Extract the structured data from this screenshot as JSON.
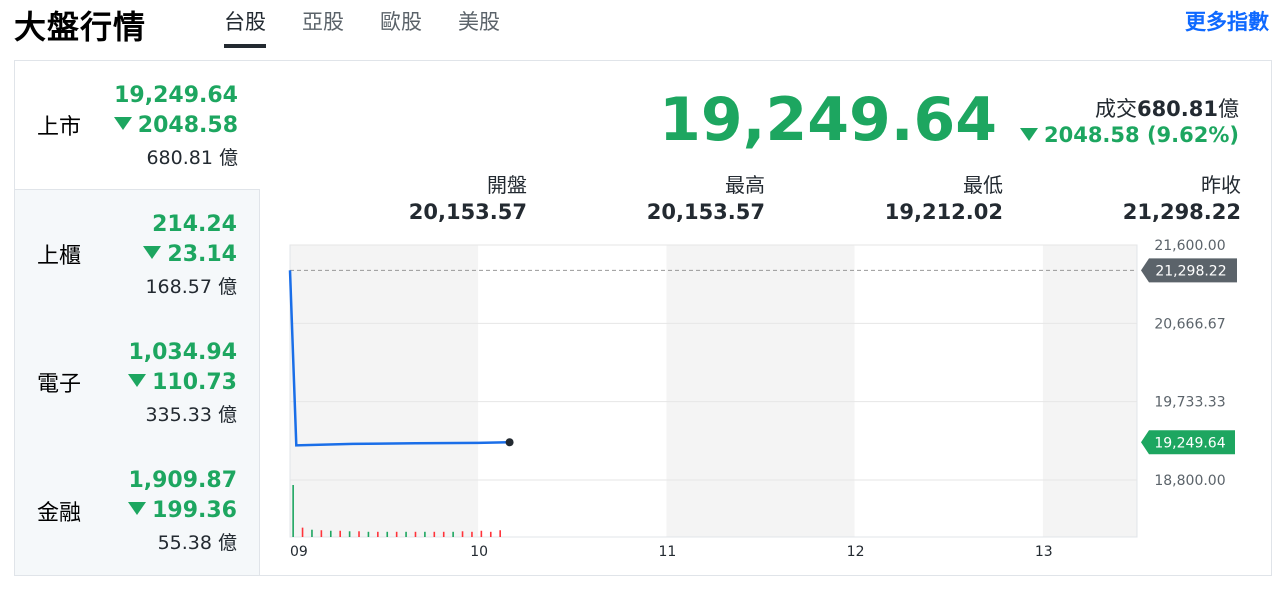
{
  "page_title": "大盤行情",
  "tabs": [
    {
      "label": "台股",
      "active": true
    },
    {
      "label": "亞股",
      "active": false
    },
    {
      "label": "歐股",
      "active": false
    },
    {
      "label": "美股",
      "active": false
    }
  ],
  "more_label": "更多指數",
  "sidebar": [
    {
      "name": "上市",
      "price": "19,249.64",
      "change": "2048.58",
      "volume": "680.81 億",
      "active": true
    },
    {
      "name": "上櫃",
      "price": "214.24",
      "change": "23.14",
      "volume": "168.57 億",
      "active": false
    },
    {
      "name": "電子",
      "price": "1,034.94",
      "change": "110.73",
      "volume": "335.33 億",
      "active": false
    },
    {
      "name": "金融",
      "price": "1,909.87",
      "change": "199.36",
      "volume": "55.38 億",
      "active": false
    }
  ],
  "main": {
    "price": "19,249.64",
    "volume_label": "成交",
    "volume_value": "680.81",
    "volume_unit": "億",
    "change": "2048.58 (9.62%)",
    "stats": [
      {
        "label": "開盤",
        "value": "20,153.57"
      },
      {
        "label": "最高",
        "value": "20,153.57"
      },
      {
        "label": "最低",
        "value": "19,212.02"
      },
      {
        "label": "昨收",
        "value": "21,298.22"
      }
    ]
  },
  "colors": {
    "down": "#1da660",
    "up": "#ff333a",
    "line": "#1a6ee8",
    "accent": "#0f69ff"
  },
  "chart_data": {
    "type": "line",
    "x_ticks": [
      "09",
      "10",
      "11",
      "12",
      "13"
    ],
    "y_ticks": [
      "21,600.00",
      "20,666.67",
      "19,733.33",
      "18,800.00"
    ],
    "ylim": [
      18800,
      21600
    ],
    "prev_close": 21298.22,
    "prev_close_label": "21,298.22",
    "current_label": "19,249.64",
    "price_series": [
      {
        "t": 0,
        "v": 21298.22
      },
      {
        "t": 2,
        "v": 19212.02
      },
      {
        "t": 20,
        "v": 19230
      },
      {
        "t": 40,
        "v": 19238
      },
      {
        "t": 60,
        "v": 19242
      },
      {
        "t": 70,
        "v": 19249.64
      }
    ],
    "volume_bars": [
      {
        "t": 1,
        "v": 1.0,
        "dir": "down"
      },
      {
        "t": 4,
        "v": 0.18,
        "dir": "up"
      },
      {
        "t": 7,
        "v": 0.14,
        "dir": "down"
      },
      {
        "t": 10,
        "v": 0.13,
        "dir": "up"
      },
      {
        "t": 13,
        "v": 0.12,
        "dir": "down"
      },
      {
        "t": 16,
        "v": 0.12,
        "dir": "up"
      },
      {
        "t": 19,
        "v": 0.11,
        "dir": "down"
      },
      {
        "t": 22,
        "v": 0.11,
        "dir": "up"
      },
      {
        "t": 25,
        "v": 0.1,
        "dir": "down"
      },
      {
        "t": 28,
        "v": 0.1,
        "dir": "up"
      },
      {
        "t": 31,
        "v": 0.1,
        "dir": "down"
      },
      {
        "t": 34,
        "v": 0.1,
        "dir": "up"
      },
      {
        "t": 37,
        "v": 0.1,
        "dir": "down"
      },
      {
        "t": 40,
        "v": 0.1,
        "dir": "up"
      },
      {
        "t": 43,
        "v": 0.1,
        "dir": "down"
      },
      {
        "t": 46,
        "v": 0.1,
        "dir": "up"
      },
      {
        "t": 49,
        "v": 0.1,
        "dir": "up"
      },
      {
        "t": 52,
        "v": 0.1,
        "dir": "down"
      },
      {
        "t": 55,
        "v": 0.11,
        "dir": "up"
      },
      {
        "t": 58,
        "v": 0.1,
        "dir": "up"
      },
      {
        "t": 61,
        "v": 0.12,
        "dir": "up"
      },
      {
        "t": 64,
        "v": 0.1,
        "dir": "up"
      },
      {
        "t": 67,
        "v": 0.13,
        "dir": "up"
      }
    ]
  }
}
